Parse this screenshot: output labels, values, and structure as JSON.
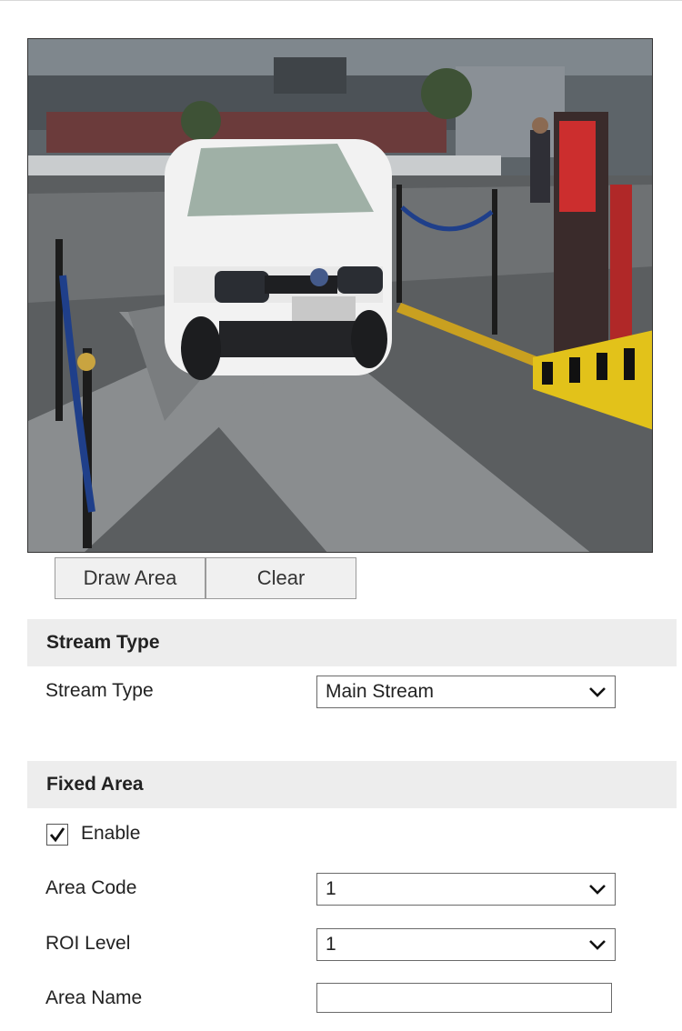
{
  "preview": {
    "image_description_icon": "camera-snapshot-icon"
  },
  "draw_buttons": {
    "draw_area": "Draw Area",
    "clear": "Clear"
  },
  "stream_section": {
    "header": "Stream Type",
    "stream_type_label": "Stream Type",
    "stream_type_value": "Main Stream"
  },
  "fixed_area_section": {
    "header": "Fixed Area",
    "enable_label": "Enable",
    "enable_checked": true,
    "area_code_label": "Area Code",
    "area_code_value": "1",
    "roi_level_label": "ROI Level",
    "roi_level_value": "1",
    "area_name_label": "Area Name",
    "area_name_value": ""
  },
  "colors": {
    "section_bg": "#ededed",
    "button_bg": "#f0f0f0",
    "border": "#6a6a6a"
  }
}
